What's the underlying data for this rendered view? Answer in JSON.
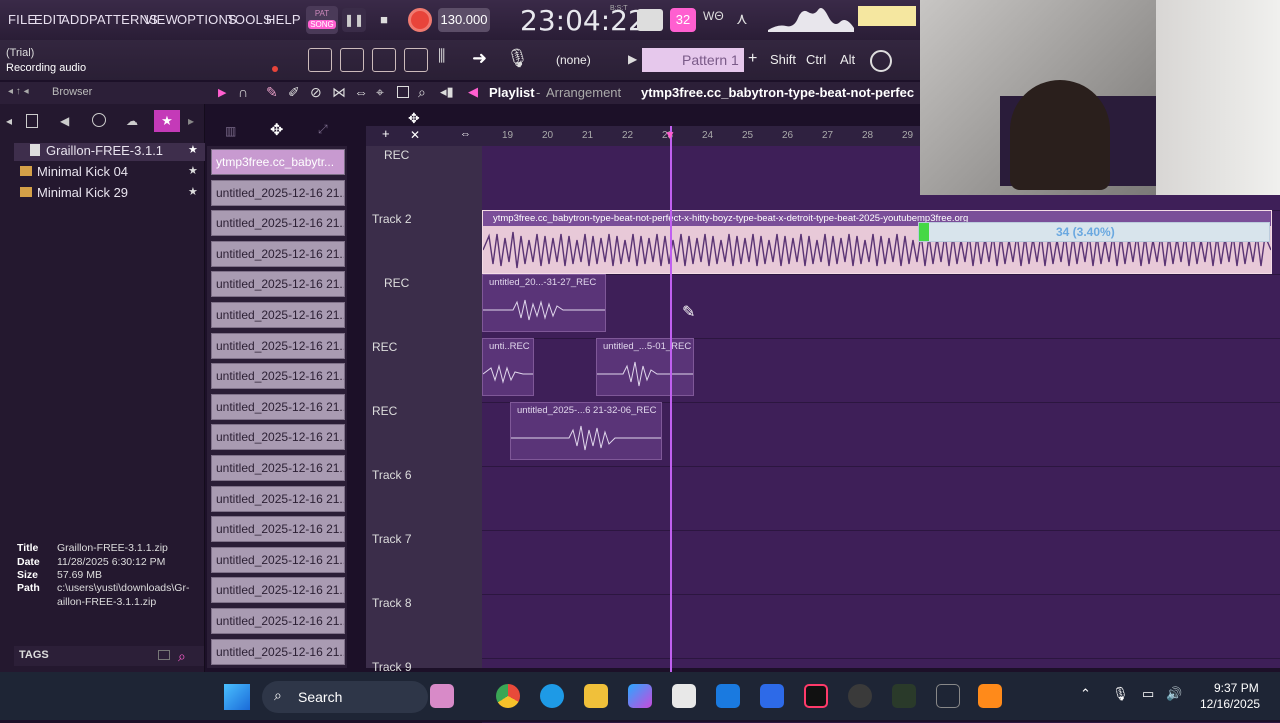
{
  "menu": [
    "FILE",
    "EDIT",
    "ADD",
    "PATTERNS",
    "VIEW",
    "OPTIONS",
    "TOOLS",
    "HELP"
  ],
  "transport": {
    "mode_top": "PAT",
    "mode_bottom": "SONG",
    "tempo": "130.000",
    "time": "23:04:22",
    "time_label": "B:S:T",
    "cpu": "32"
  },
  "hint": {
    "line1": "(Trial)",
    "line2": "Recording audio"
  },
  "toolbar2": {
    "pattern_none": "(none)",
    "pattern": "Pattern 1",
    "shift": "Shift",
    "ctrl": "Ctrl",
    "alt": "Alt"
  },
  "browser": {
    "title": "Browser",
    "items": [
      {
        "label": "Graillon-FREE-3.1.1"
      },
      {
        "label": "Minimal Kick 04"
      },
      {
        "label": "Minimal Kick 29"
      }
    ],
    "info": {
      "title_lbl": "Title",
      "title": "Graillon-FREE-3.1.1.zip",
      "date_lbl": "Date",
      "date": "11/28/2025 6:30:12 PM",
      "size_lbl": "Size",
      "size": "57.69 MB",
      "path_lbl": "Path",
      "path1": "c:\\users\\yusti\\downloads\\Gr-",
      "path2": "aillon-FREE-3.1.1.zip"
    },
    "tags": "TAGS"
  },
  "playlist": {
    "title": "Playlist",
    "sep": "-",
    "sub": "Arrangement",
    "file": "ytmp3free.cc_babytron-type-beat-not-perfec"
  },
  "ruler": [
    "19",
    "20",
    "21",
    "22",
    "23",
    "24",
    "25",
    "26",
    "27",
    "28",
    "29"
  ],
  "clips": [
    "ytmp3free.cc_babytr...",
    "untitled_2025-12-16 21...",
    "untitled_2025-12-16 21...",
    "untitled_2025-12-16 21...",
    "untitled_2025-12-16 21...",
    "untitled_2025-12-16 21...",
    "untitled_2025-12-16 21...",
    "untitled_2025-12-16 21...",
    "untitled_2025-12-16 21...",
    "untitled_2025-12-16 21...",
    "untitled_2025-12-16 21...",
    "untitled_2025-12-16 21...",
    "untitled_2025-12-16 21...",
    "untitled_2025-12-16 21...",
    "untitled_2025-12-16 21...",
    "untitled_2025-12-16 21...",
    "untitled_2025-12-16 21..."
  ],
  "tracks": [
    "REC",
    "Track 2",
    "REC",
    "REC",
    "REC",
    "Track 6",
    "Track 7",
    "Track 8",
    "Track 9"
  ],
  "arr_clips": {
    "beat": "ytmp3free.cc_babytron-type-beat-not-perfect-x-hitty-boyz-type-beat-x-detroit-type-beat-2025-youtubemp3free.org",
    "c1": "untitled_20...-31-27_REC",
    "c2": "unti..REC",
    "c3": "untitled_...5-01_REC",
    "c4": "untitled_2025-...6 21-32-06_REC"
  },
  "overlay": {
    "count": "34 (3.40%)"
  },
  "taskbar": {
    "search": "Search",
    "time": "9:37 PM",
    "date": "12/16/2025"
  },
  "colors": {
    "accent": "#ff5fd0",
    "grid": "#3e1f58",
    "beat_clip": "#e8c9d8"
  }
}
